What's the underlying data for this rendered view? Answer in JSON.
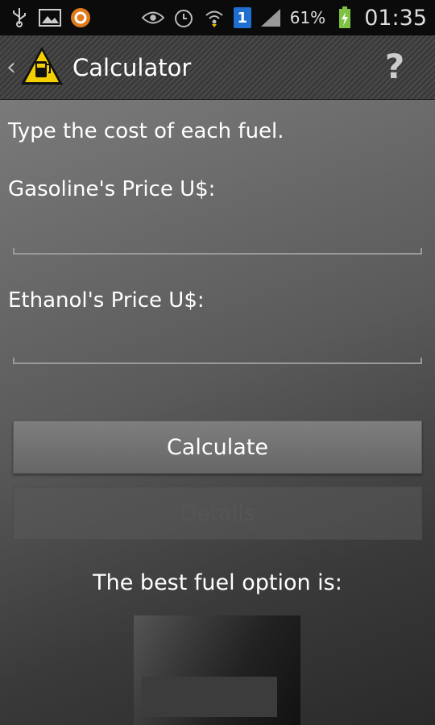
{
  "statusbar": {
    "left_icons": [
      "usb-icon",
      "image-icon",
      "circle-app-icon"
    ],
    "right_icons": [
      "eye-icon",
      "alarm-icon",
      "wifi-icon",
      "sim-icon",
      "signal-icon"
    ],
    "sim_number": "1",
    "battery": "61%",
    "time": "01:35"
  },
  "actionbar": {
    "title": "Calculator",
    "help_label": "?"
  },
  "form": {
    "intro": "Type the cost of each fuel.",
    "gasoline_label": "Gasoline's Price U$:",
    "gasoline_value": "",
    "ethanol_label": "Ethanol's Price U$:",
    "ethanol_value": "",
    "calculate_label": "Calculate",
    "details_label": "Details"
  },
  "result": {
    "heading": "The best fuel option is:"
  },
  "colors": {
    "accent_yellow": "#f5d000",
    "battery_green": "#7dc242",
    "sim_blue": "#1e6fd0"
  }
}
